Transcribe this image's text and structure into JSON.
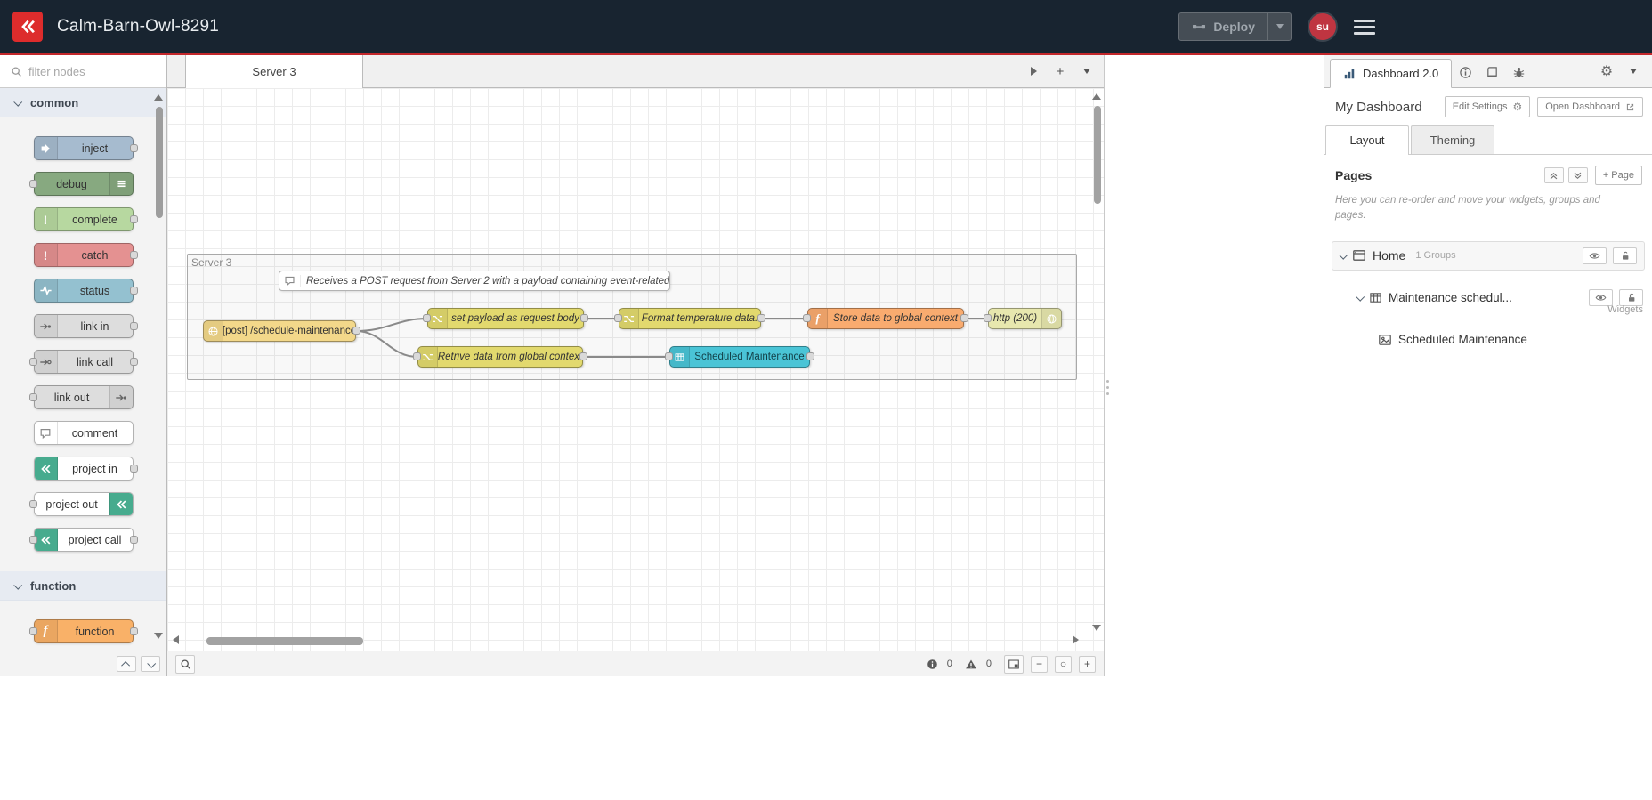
{
  "colors": {
    "header_bg": "#182430",
    "brand_red": "#dd2c2c",
    "header_underline": "#c3272b",
    "node_inject": "#a6bbcf",
    "node_debug": "#87a980",
    "node_complete": "#b7d8a0",
    "node_catch": "#e49191",
    "node_status": "#94c1d0",
    "node_link": "#dddddd",
    "node_project_icon": "#47ab8e",
    "node_function": "#f9b168",
    "node_http_in": "#f3d88a",
    "node_change": "#e2d96e",
    "node_http_response": "#e7e7ae",
    "node_ui_table": "#4ac4d6"
  },
  "header": {
    "title": "Calm-Barn-Owl-8291",
    "deploy_label": "Deploy",
    "user_initials": "su"
  },
  "palette": {
    "search_placeholder": "filter nodes",
    "categories": [
      {
        "label": "common",
        "nodes": [
          {
            "label": "inject"
          },
          {
            "label": "debug"
          },
          {
            "label": "complete"
          },
          {
            "label": "catch"
          },
          {
            "label": "status"
          },
          {
            "label": "link in"
          },
          {
            "label": "link call"
          },
          {
            "label": "link out"
          },
          {
            "label": "comment"
          },
          {
            "label": "project in"
          },
          {
            "label": "project out"
          },
          {
            "label": "project call"
          }
        ]
      },
      {
        "label": "function",
        "nodes": [
          {
            "label": "function"
          }
        ]
      }
    ]
  },
  "workspace": {
    "tab_label": "Server 3",
    "tabbar": {
      "add_button": "+"
    },
    "group_label": "Server 3",
    "comment_text": "Receives a POST request from Server 2 with a payload containing event-related data.",
    "nodes": [
      {
        "label": "[post] /schedule-maintenance",
        "type": "http in"
      },
      {
        "label": "set payload as request body",
        "type": "change"
      },
      {
        "label": "Format temperature data.",
        "type": "change"
      },
      {
        "label": "Store data to global context",
        "type": "function"
      },
      {
        "label": "http (200)",
        "type": "http response"
      },
      {
        "label": "Retrive data from global context",
        "type": "change"
      },
      {
        "label": "Scheduled Maintenance",
        "type": "ui-table"
      }
    ],
    "footer": {
      "info_count": "0",
      "warning_count": "0",
      "zoom_out": "−",
      "zoom_reset": "○",
      "zoom_in": "+"
    }
  },
  "sidebar": {
    "active_tab_label": "Dashboard 2.0",
    "dashboard_name": "My Dashboard",
    "edit_settings_label": "Edit Settings",
    "open_dashboard_label": "Open Dashboard",
    "tab_layout": "Layout",
    "tab_theming": "Theming",
    "pages_title": "Pages",
    "add_page_label": "+ Page",
    "description": "Here you can re-order and move your widgets, groups and pages.",
    "tree": {
      "page_name": "Home",
      "page_meta": "1 Groups",
      "group_name": "Maintenance schedul...",
      "widgets_label": "Widgets",
      "widget_name": "Scheduled Maintenance"
    }
  }
}
